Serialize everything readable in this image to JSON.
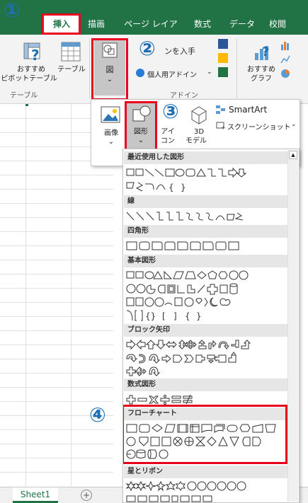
{
  "tabs": [
    {
      "label": "挿入",
      "active": true
    },
    {
      "label": "描画"
    },
    {
      "label": "ページ レイアウト"
    },
    {
      "label": "数式"
    },
    {
      "label": "データ"
    },
    {
      "label": "校閲"
    }
  ],
  "ribbon": {
    "tables": {
      "pivot_label_1": "おすすめ",
      "pivot_label_2": "ピボットテーブル",
      "table_label": "テーブル",
      "group_label": "テーブル"
    },
    "illustrations": {
      "button_label": "図",
      "chevron": "⌄"
    },
    "addins": {
      "get_addins_label": "ンを入手",
      "my_addins_label": "個人用アドイン",
      "group_label": "アドイン"
    },
    "charts": {
      "recommended_label_1": "おすすめ",
      "recommended_label_2": "グラフ"
    }
  },
  "picture_panel": {
    "picture_label": "画像",
    "shapes_label": "図形",
    "icons_label_1": "アイ",
    "icons_label_2": "コン",
    "model3d_label_1": "3D",
    "model3d_label_2": "モデル",
    "smartart_label": "SmartArt",
    "screenshot_label": "スクリーンショット"
  },
  "badges": {
    "b1": "①",
    "b2": "②",
    "b3": "③",
    "b4": "④"
  },
  "shape_panel": {
    "categories": [
      {
        "key": "recent",
        "label": "最近使用した図形"
      },
      {
        "key": "lines",
        "label": "線"
      },
      {
        "key": "rects",
        "label": "四角形"
      },
      {
        "key": "basic",
        "label": "基本図形"
      },
      {
        "key": "arrows",
        "label": "ブロック矢印"
      },
      {
        "key": "equation",
        "label": "数式図形"
      },
      {
        "key": "flowchart",
        "label": "フローチャート"
      },
      {
        "key": "stars",
        "label": "星とリボン"
      }
    ]
  },
  "sheet_tab": {
    "label": "Sheet1",
    "add": "+"
  },
  "colors": {
    "accent": "#217346",
    "highlight": "#e8001c",
    "badge": "#1f6fb5"
  }
}
